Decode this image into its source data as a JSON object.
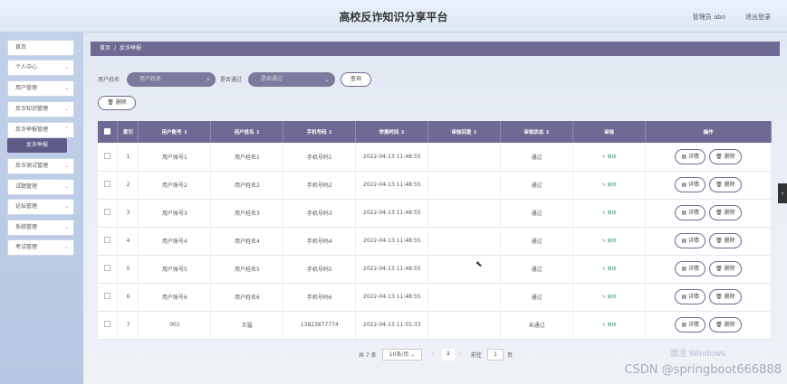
{
  "header": {
    "title": "高校反诈知识分享平台",
    "admin": "管理员 abo",
    "logout": "退出登录"
  },
  "sidebar": {
    "items": [
      {
        "label": "首页"
      },
      {
        "label": "个人中心"
      },
      {
        "label": "用户管理"
      },
      {
        "label": "反诈知识管理"
      },
      {
        "label": "反诈举报管理"
      },
      {
        "label": "反诈测试管理"
      },
      {
        "label": "试题管理"
      },
      {
        "label": "论坛管理"
      },
      {
        "label": "系统管理"
      },
      {
        "label": "考试管理"
      }
    ],
    "active_sub": "反诈举报"
  },
  "breadcrumb": {
    "home": "首页",
    "sep": "/",
    "current": "反诈举报"
  },
  "search": {
    "user_name_label": "用户姓名",
    "user_name_placeholder": "用户姓名",
    "passed_label": "是否通过",
    "passed_placeholder": "是否通过",
    "query_button": "查询"
  },
  "toolbar": {
    "delete_button": "删除"
  },
  "table": {
    "headers": [
      "索引",
      "用户账号 ⇕",
      "用户姓名 ⇕",
      "手机号码 ⇕",
      "举报时间 ⇕",
      "审核回复 ⇕",
      "审核状态 ⇕",
      "审核",
      "操作"
    ],
    "rows": [
      {
        "idx": "1",
        "account": "用户账号1",
        "name": "用户姓名1",
        "phone": "手机号码1",
        "time": "2022-04-13 11:48:55",
        "reply": "",
        "status": "通过",
        "review": "审核"
      },
      {
        "idx": "2",
        "account": "用户账号2",
        "name": "用户姓名2",
        "phone": "手机号码2",
        "time": "2022-04-13 11:48:55",
        "reply": "",
        "status": "通过",
        "review": "审核"
      },
      {
        "idx": "3",
        "account": "用户账号3",
        "name": "用户姓名3",
        "phone": "手机号码3",
        "time": "2022-04-13 11:48:55",
        "reply": "",
        "status": "通过",
        "review": "审核"
      },
      {
        "idx": "4",
        "account": "用户账号4",
        "name": "用户姓名4",
        "phone": "手机号码4",
        "time": "2022-04-13 11:48:55",
        "reply": "",
        "status": "通过",
        "review": "审核"
      },
      {
        "idx": "5",
        "account": "用户账号5",
        "name": "用户姓名5",
        "phone": "手机号码5",
        "time": "2022-04-13 11:48:55",
        "reply": "",
        "status": "通过",
        "review": "审核"
      },
      {
        "idx": "6",
        "account": "用户账号6",
        "name": "用户姓名6",
        "phone": "手机号码6",
        "time": "2022-04-13 11:48:55",
        "reply": "",
        "status": "通过",
        "review": "审核"
      },
      {
        "idx": "7",
        "account": "001",
        "name": "王猛",
        "phone": "13823877774",
        "time": "2022-04-13 11:55:33",
        "reply": "",
        "status": "未通过",
        "review": "审核"
      }
    ],
    "detail_label": "详情",
    "delete_label": "删除"
  },
  "pagination": {
    "total": "共 7 条",
    "page_size": "10条/页",
    "current_page": "1",
    "goto_label": "前往",
    "goto_value": "1",
    "page_unit": "页"
  },
  "watermark": "CSDN @springboot666888",
  "colors": {
    "primary": "#6e6a93",
    "success": "#3aa56c"
  }
}
